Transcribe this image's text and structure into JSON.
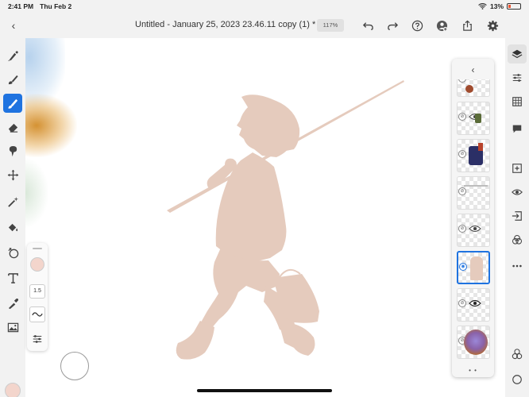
{
  "status": {
    "time": "2:41 PM",
    "date": "Thu Feb 2",
    "battery": "13%"
  },
  "topbar": {
    "title": "Untitled - January 25, 2023 23.46.11 copy (1) *",
    "zoom": "117%"
  },
  "brush_panel": {
    "size": "1.5",
    "color": "#f3d5cc"
  },
  "colors": {
    "accent": "#1f73e0",
    "silhouette": "#e5cbbd",
    "selected_color": "#f3d5cc"
  },
  "left_tools": [
    "pixel-brush-icon",
    "live-brush-icon",
    "vector-brush-icon",
    "eraser-icon",
    "smudge-icon",
    "move-icon",
    "selection-wand-icon",
    "fill-icon",
    "liquify-icon",
    "text-icon",
    "eyedropper-icon",
    "image-icon"
  ],
  "right_tools": [
    "layers-icon",
    "layer-properties-icon",
    "grid-icon",
    "comment-icon",
    "add-layer-icon",
    "visibility-icon",
    "import-layer-icon",
    "blend-icon",
    "more-icon"
  ],
  "layers": [
    "layer-1",
    "layer-2",
    "layer-3",
    "layer-4",
    "layer-5",
    "layer-6",
    "layer-7",
    "layer-8"
  ]
}
